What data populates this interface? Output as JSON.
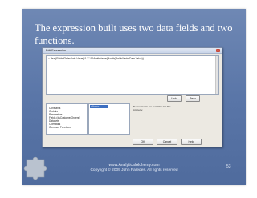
{
  "slide": {
    "title": "The expression built uses two data fields and two functions.",
    "footer_site": "www.AnalyticalAlchemy.com",
    "footer_copyright": "Copyright © 2009 John Paredes. All rights reserved",
    "page_number": "53"
  },
  "dialog": {
    "title": "Edit Expression",
    "close_label": "x",
    "expression": "= Year(Fields!OrderDate.Value) & \" \" & MonthName(Month(Fields!OrderDate.Value))",
    "undo_label": "Undo",
    "redo_label": "Redo",
    "tree_items": [
      "Constants",
      "Globals",
      "Parameters",
      "Fields (dsCustomerOrders)",
      "Datasets",
      "Operators",
      "Common Functions"
    ],
    "selected_item": "<Auto>",
    "description": "No constants are available for this property.",
    "ok_label": "OK",
    "cancel_label": "Cancel",
    "help_label": "Help"
  }
}
